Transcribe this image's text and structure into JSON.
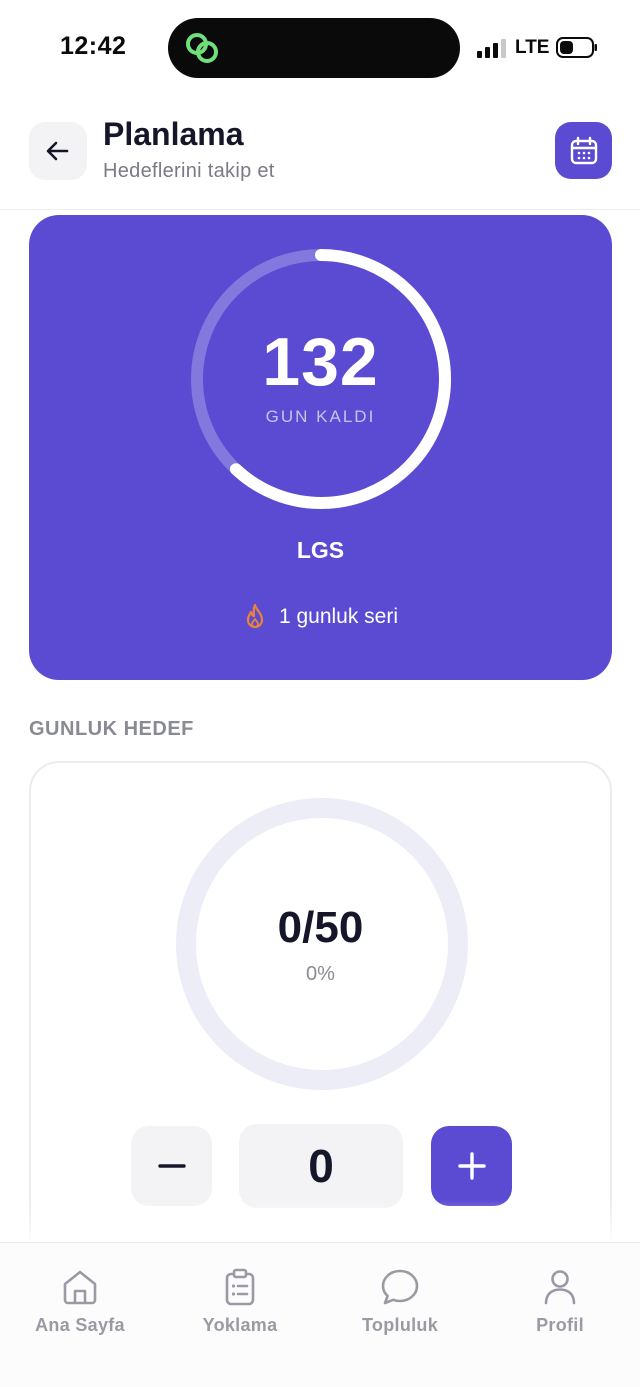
{
  "status_bar": {
    "time": "12:42",
    "network": "LTE",
    "signal_bars_filled": 3,
    "signal_bars_total": 4
  },
  "header": {
    "title": "Planlama",
    "subtitle": "Hedeflerini takip et"
  },
  "countdown": {
    "days": "132",
    "days_label": "GUN KALDI",
    "exam": "LGS",
    "streak_text": "1 gunluk seri",
    "ring_progress": 0.62
  },
  "daily_goal": {
    "section_label": "GUNLUK HEDEF",
    "count_text": "0/50",
    "percent_text": "0%",
    "progress": 0,
    "counter_value": "0",
    "minus_symbol": "−",
    "plus_symbol": "+"
  },
  "nav": {
    "items": [
      {
        "label": "Ana Sayfa",
        "icon": "home-icon"
      },
      {
        "label": "Yoklama",
        "icon": "clipboard-icon"
      },
      {
        "label": "Topluluk",
        "icon": "chat-bubble-icon"
      },
      {
        "label": "Profil",
        "icon": "user-icon"
      }
    ]
  },
  "colors": {
    "accent": "#5a4bd2",
    "ring_track": "#ededf8",
    "streak_flame": "#e8843a",
    "island_icon": "#6fe07a"
  }
}
